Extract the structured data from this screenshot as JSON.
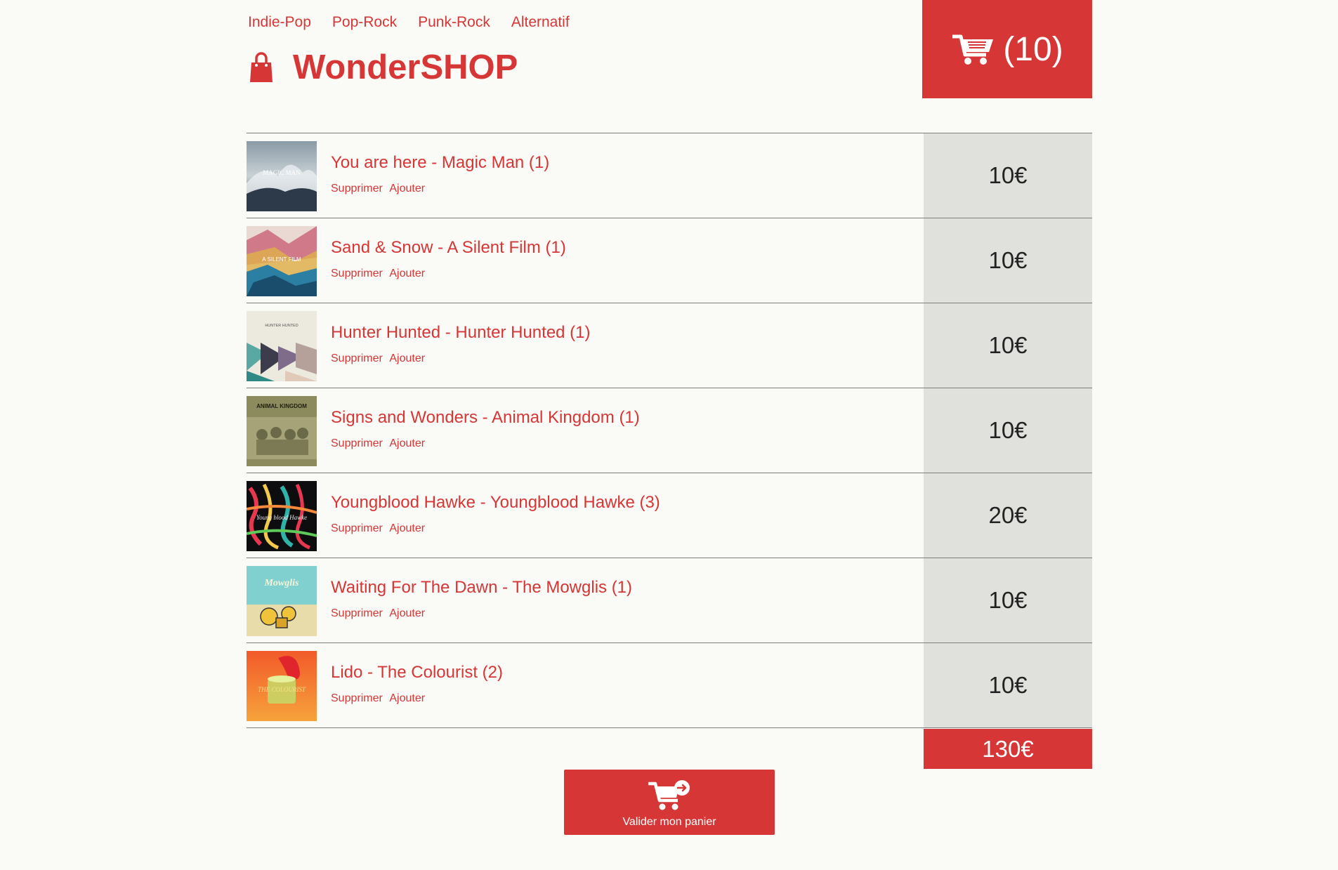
{
  "nav": {
    "items": [
      "Indie-Pop",
      "Pop-Rock",
      "Punk-Rock",
      "Alternatif"
    ]
  },
  "brand": {
    "name": "WonderSHOP",
    "icon": "shopping-bag-icon"
  },
  "cart": {
    "count_label": "(10)",
    "icon": "cart-icon"
  },
  "items": [
    {
      "title": "You are here - Magic Man (1)",
      "remove_label": "Supprimer",
      "add_label": "Ajouter",
      "price": "10€",
      "cover_text": "MAGIC MAN"
    },
    {
      "title": "Sand & Snow - A Silent Film (1)",
      "remove_label": "Supprimer",
      "add_label": "Ajouter",
      "price": "10€",
      "cover_text": "A SILENT FILM"
    },
    {
      "title": "Hunter Hunted - Hunter Hunted (1)",
      "remove_label": "Supprimer",
      "add_label": "Ajouter",
      "price": "10€",
      "cover_text": "HUNTER HUNTED"
    },
    {
      "title": "Signs and Wonders - Animal Kingdom (1)",
      "remove_label": "Supprimer",
      "add_label": "Ajouter",
      "price": "10€",
      "cover_text": "ANIMAL KINGDOM"
    },
    {
      "title": "Youngblood Hawke - Youngblood Hawke (3)",
      "remove_label": "Supprimer",
      "add_label": "Ajouter",
      "price": "20€",
      "cover_text": "Young blood Hawke"
    },
    {
      "title": "Waiting For The Dawn - The Mowglis (1)",
      "remove_label": "Supprimer",
      "add_label": "Ajouter",
      "price": "10€",
      "cover_text": "Mowglis"
    },
    {
      "title": "Lido - The Colourist (2)",
      "remove_label": "Supprimer",
      "add_label": "Ajouter",
      "price": "10€",
      "cover_text": "THE COLOURIST"
    }
  ],
  "total": "130€",
  "checkout": {
    "label": "Valider mon panier",
    "icon": "cart-checkout-icon"
  },
  "colors": {
    "accent": "#d63636",
    "price_bg": "#e0e0dc",
    "page_bg": "#fafaf6"
  }
}
